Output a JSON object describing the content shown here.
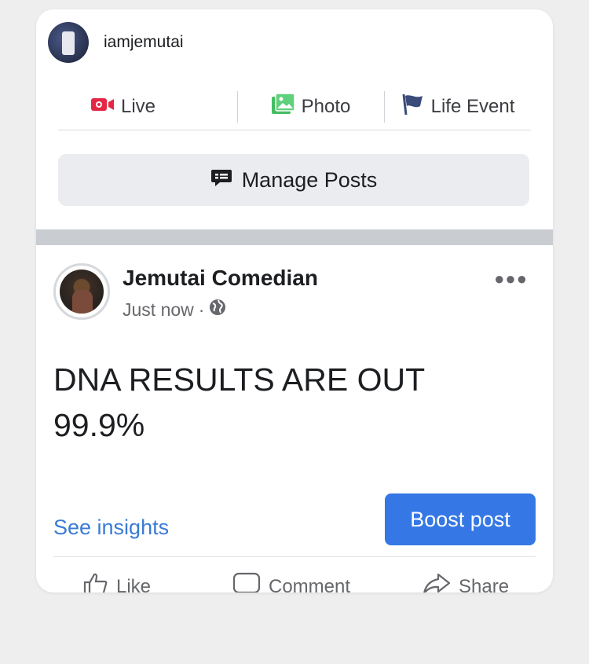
{
  "composer": {
    "username": "iamjemutai",
    "actions": [
      {
        "label": "Live",
        "icon": "live-video-icon",
        "color": "#e42645"
      },
      {
        "label": "Photo",
        "icon": "photo-icon",
        "color": "#45bd62"
      },
      {
        "label": "Life Event",
        "icon": "flag-icon",
        "color": "#3b4b7a"
      }
    ],
    "manage_posts_label": "Manage Posts"
  },
  "post": {
    "page_name": "Jemutai Comedian",
    "timestamp": "Just now",
    "privacy_icon": "globe-icon",
    "text_lines": [
      "DNA RESULTS ARE OUT",
      "99.9%"
    ],
    "see_insights_label": "See insights",
    "boost_label": "Boost post",
    "reactions": [
      {
        "label": "Like",
        "icon": "thumbs-up-icon"
      },
      {
        "label": "Comment",
        "icon": "comment-icon"
      },
      {
        "label": "Share",
        "icon": "share-icon"
      }
    ]
  },
  "colors": {
    "accent_blue": "#3578e5",
    "link_blue": "#3a7bd5",
    "background": "#eeeeee"
  }
}
